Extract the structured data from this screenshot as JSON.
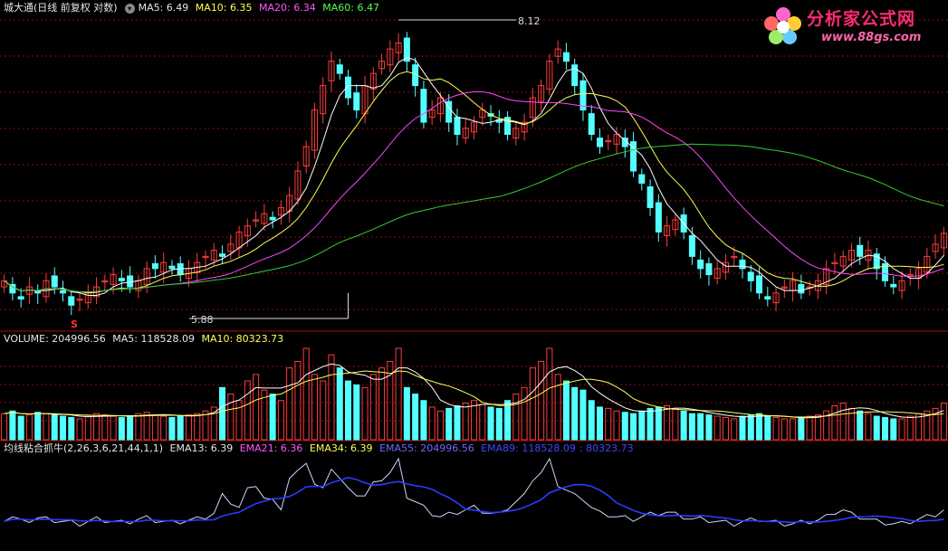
{
  "main_header": {
    "title": "城大通(日线 前复权 对数)",
    "ma5": "MA5: 6.49",
    "ma10": "MA10: 6.35",
    "ma20": "MA20: 6.34",
    "ma60": "MA60: 6.47",
    "settings_glyph": "▾"
  },
  "annotations": {
    "high_label": "8.12",
    "low_label": "5.88",
    "signal_mark": "S"
  },
  "volume_header": {
    "volume": "VOLUME: 204996.56",
    "ma5": "MA5: 118528.09",
    "ma10": "MA10: 80323.73"
  },
  "indicator_header": {
    "name": "均线粘合抓牛(2,26,3,6,21,44,1,1)",
    "ema13": "EMA13: 6.39",
    "ema21": "EMA21: 6.36",
    "ema34": "EMA34: 6.39",
    "ema55": "EMA55: 204996.56",
    "ema89": "EMA89: 118528.09",
    "ema_last": ": 80323.73"
  },
  "logo": {
    "title": "分析家公式网",
    "url": "www.88gs.com"
  },
  "colors": {
    "up": "#ff3b3b",
    "down": "#54ffff",
    "ma5": "#ffffff",
    "ma10": "#ffff55",
    "ma20": "#ff44ff",
    "ma60": "#33cc33",
    "gridline": "#8b1010",
    "indicator_light": "#c8d8ff",
    "indicator_dark": "#2a3cff"
  },
  "chart_data": [
    {
      "type": "candlestick",
      "title": "城大通(日线 前复权 对数)",
      "series": [
        {
          "name": "MA5",
          "last": 6.49
        },
        {
          "name": "MA10",
          "last": 6.35
        },
        {
          "name": "MA20",
          "last": 6.34
        },
        {
          "name": "MA60",
          "last": 6.47
        }
      ],
      "max_price": 8.12,
      "min_price": 5.88,
      "closes": [
        6.1,
        6.0,
        5.95,
        6.05,
        6.0,
        6.1,
        6.05,
        6.0,
        5.9,
        5.95,
        6.0,
        6.05,
        6.1,
        6.15,
        6.1,
        6.05,
        6.1,
        6.2,
        6.2,
        6.25,
        6.2,
        6.15,
        6.2,
        6.25,
        6.3,
        6.35,
        6.3,
        6.4,
        6.5,
        6.55,
        6.6,
        6.65,
        6.6,
        6.7,
        6.8,
        7.0,
        7.2,
        7.5,
        7.7,
        7.9,
        7.8,
        7.6,
        7.5,
        7.7,
        7.8,
        7.9,
        8.0,
        8.05,
        7.9,
        7.7,
        7.4,
        7.5,
        7.6,
        7.4,
        7.3,
        7.35,
        7.4,
        7.5,
        7.45,
        7.4,
        7.3,
        7.35,
        7.4,
        7.6,
        7.7,
        7.9,
        8.0,
        7.9,
        7.7,
        7.5,
        7.3,
        7.2,
        7.25,
        7.3,
        7.2,
        7.0,
        6.9,
        6.7,
        6.5,
        6.55,
        6.6,
        6.5,
        6.3,
        6.2,
        6.15,
        6.2,
        6.25,
        6.3,
        6.2,
        6.1,
        6.0,
        5.95,
        6.0,
        6.05,
        6.1,
        6.0,
        6.05,
        6.1,
        6.2,
        6.25,
        6.3,
        6.35,
        6.3,
        6.35,
        6.2,
        6.1,
        6.05,
        6.1,
        6.15,
        6.2,
        6.3,
        6.4,
        6.49
      ]
    },
    {
      "type": "bar",
      "title": "VOLUME",
      "series": [
        {
          "name": "VOLUME",
          "last": 204996.56
        },
        {
          "name": "MA5",
          "last": 118528.09
        },
        {
          "name": "MA10",
          "last": 80323.73
        }
      ],
      "values": [
        20,
        22,
        18,
        19,
        21,
        20,
        19,
        18,
        17,
        16,
        18,
        20,
        19,
        18,
        17,
        18,
        20,
        21,
        19,
        18,
        17,
        18,
        19,
        20,
        22,
        25,
        40,
        35,
        30,
        45,
        50,
        38,
        35,
        30,
        55,
        60,
        70,
        50,
        45,
        65,
        55,
        45,
        42,
        40,
        50,
        55,
        60,
        70,
        40,
        35,
        30,
        25,
        22,
        24,
        26,
        28,
        30,
        27,
        25,
        24,
        30,
        35,
        40,
        55,
        60,
        70,
        50,
        45,
        40,
        38,
        30,
        25,
        24,
        22,
        21,
        20,
        22,
        24,
        25,
        26,
        24,
        22,
        20,
        20,
        19,
        18,
        17,
        16,
        18,
        19,
        20,
        18,
        17,
        16,
        16,
        17,
        18,
        19,
        22,
        26,
        28,
        24,
        22,
        20,
        18,
        17,
        16,
        16,
        18,
        20,
        22,
        24,
        28
      ]
    },
    {
      "type": "line",
      "title": "均线粘合抓牛(2,26,3,6,21,44,1,1)",
      "series": [
        {
          "name": "EMA13",
          "last": 6.39
        },
        {
          "name": "EMA21",
          "last": 6.36
        },
        {
          "name": "EMA34",
          "last": 6.39
        },
        {
          "name": "EMA55",
          "last": 204996.56
        },
        {
          "name": "EMA89",
          "last": 118528.09
        }
      ]
    }
  ]
}
